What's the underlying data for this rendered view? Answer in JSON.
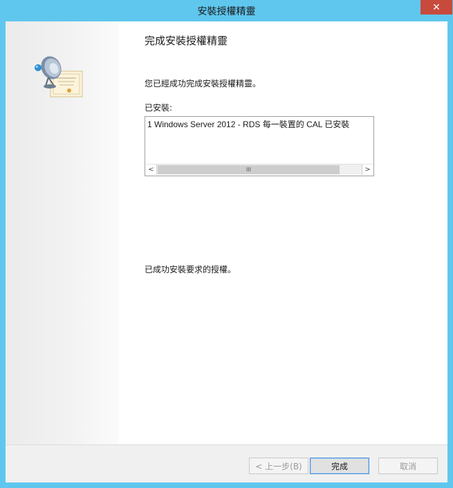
{
  "window": {
    "title": "安裝授權精靈"
  },
  "content": {
    "heading": "完成安裝授權精靈",
    "message": "您已經成功完成安裝授權精靈。",
    "installed_label": "已安裝:",
    "installed_items": [
      "1 Windows Server 2012 - RDS 每一裝置的 CAL 已安裝"
    ],
    "success_text": "已成功安裝要求的授權。"
  },
  "buttons": {
    "back": "< 上一步(B)",
    "finish": "完成",
    "cancel": "取消"
  },
  "icons": {
    "close": "close-icon",
    "wizard": "license-certificate-satellite-icon"
  },
  "colors": {
    "frame": "#5fc7ee",
    "close": "#c74a3c"
  }
}
